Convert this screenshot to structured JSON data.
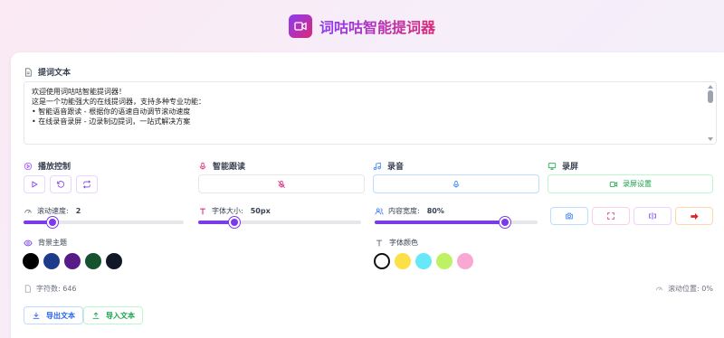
{
  "app": {
    "title": "词咕咕智能提词器"
  },
  "editor": {
    "label": "提词文本",
    "lines": [
      "欢迎使用词咕咕智能提词器！",
      "",
      "这是一个功能强大的在线提词器，支持多种专业功能：",
      "",
      "• 智能语音跟读 - 根据你的语速自动调节滚动速度",
      "• 在线录音录屏 - 边录制边提词，一站式解决方案"
    ]
  },
  "controls": {
    "playback": {
      "label": "播放控制"
    },
    "voice_follow": {
      "label": "智能跟读"
    },
    "record_audio": {
      "label": "录音"
    },
    "record_screen": {
      "label": "录屏",
      "settings_label": "录屏设置"
    }
  },
  "sliders": {
    "speed": {
      "label": "滚动速度:",
      "value_text": "2",
      "fraction": 0.18
    },
    "font_size": {
      "label": "字体大小:",
      "value_text": "50px",
      "fraction": 0.22
    },
    "content_width": {
      "label": "内容宽度:",
      "value_text": "80%",
      "fraction": 0.8
    }
  },
  "background_theme": {
    "label": "背景主题",
    "colors": [
      "#000000",
      "#1e3a8a",
      "#581c87",
      "#14532d",
      "#111827"
    ]
  },
  "font_color": {
    "label": "字体颜色",
    "colors": [
      "#ffffff",
      "#fde047",
      "#67e8f9",
      "#bef264",
      "#f9a8d4"
    ]
  },
  "status": {
    "char_count": "字符数: 646",
    "scroll_position": "滚动位置: 0%"
  },
  "footer": {
    "export_label": "导出文本",
    "import_label": "导入文本"
  },
  "colors": {
    "accent": "#7c3aed",
    "brand_pink": "#db2777",
    "red": "#dc2626",
    "blue": "#2563eb",
    "green": "#16a34a"
  }
}
